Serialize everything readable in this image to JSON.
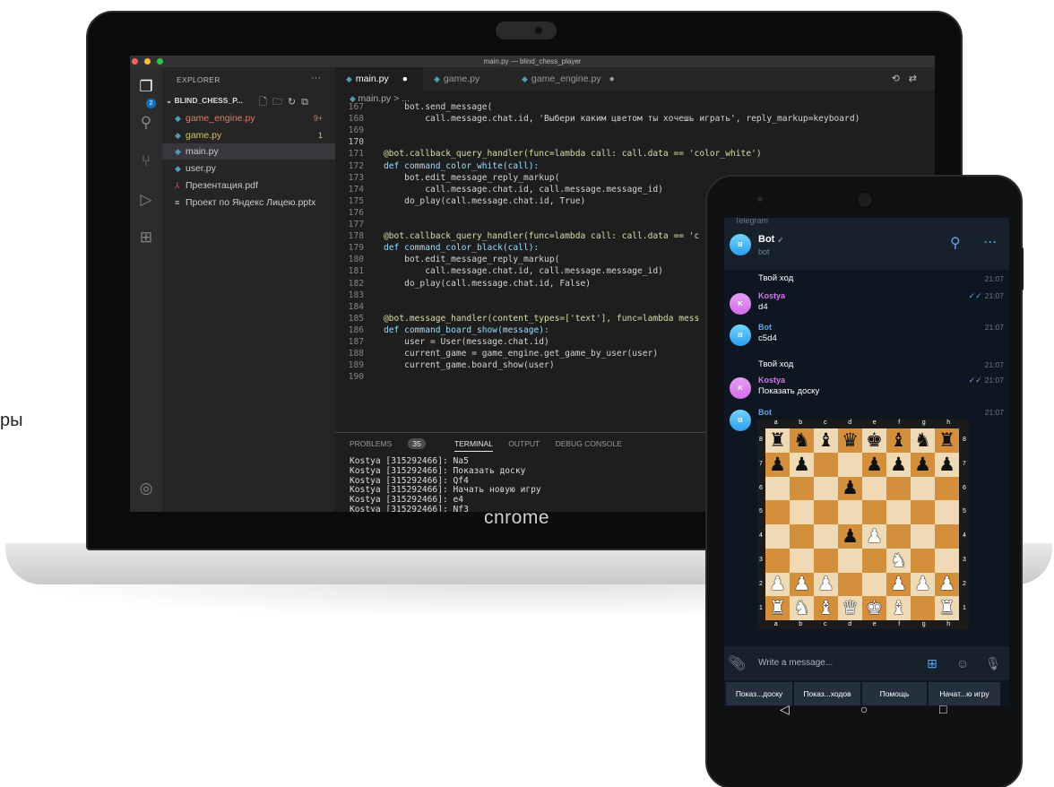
{
  "side_text": "ры",
  "laptop": {
    "brand": "cnrome",
    "window_title": "main.py — blind_chess_player",
    "explorer": {
      "header": "EXPLORER",
      "more": "···",
      "project": "BLIND_CHESS_P...",
      "files": [
        {
          "name": "game_engine.py",
          "count": "9+",
          "color": "#e07b68",
          "icon": "py"
        },
        {
          "name": "game.py",
          "count": "1",
          "color": "#d8c15f",
          "icon": "py"
        },
        {
          "name": "main.py",
          "count": "",
          "color": "#cccccc",
          "icon": "py"
        },
        {
          "name": "user.py",
          "count": "",
          "color": "#cccccc",
          "icon": "py"
        },
        {
          "name": "Презентация.pdf",
          "count": "",
          "color": "#cccccc",
          "icon": "pdf"
        },
        {
          "name": "Проект по Яндекс Лицею.pptx",
          "count": "",
          "color": "#cccccc",
          "icon": "pptx"
        }
      ],
      "activity_badge": "2"
    },
    "tabs": [
      {
        "label": "main.py",
        "marker": "●"
      },
      {
        "label": "game.py",
        "marker": ""
      },
      {
        "label": "game_engine.py",
        "marker": "●"
      }
    ],
    "breadcrumb": "main.py > ...",
    "code_lines": [
      {
        "no": "167",
        "text": "    bot.send_message("
      },
      {
        "no": "168",
        "text": "        call.message.chat.id, 'Выбери каким цветом ты хочешь играть', reply_markup=keyboard)"
      },
      {
        "no": "169",
        "text": ""
      },
      {
        "no": "170",
        "text": ""
      },
      {
        "no": "171",
        "text": "@bot.callback_query_handler(func=lambda call: call.data == 'color_white')"
      },
      {
        "no": "172",
        "text": "def command_color_white(call):"
      },
      {
        "no": "173",
        "text": "    bot.edit_message_reply_markup("
      },
      {
        "no": "174",
        "text": "        call.message.chat.id, call.message.message_id)"
      },
      {
        "no": "175",
        "text": "    do_play(call.message.chat.id, True)"
      },
      {
        "no": "176",
        "text": ""
      },
      {
        "no": "177",
        "text": ""
      },
      {
        "no": "178",
        "text": "@bot.callback_query_handler(func=lambda call: call.data == 'c"
      },
      {
        "no": "179",
        "text": "def command_color_black(call):"
      },
      {
        "no": "180",
        "text": "    bot.edit_message_reply_markup("
      },
      {
        "no": "181",
        "text": "        call.message.chat.id, call.message.message_id)"
      },
      {
        "no": "182",
        "text": "    do_play(call.message.chat.id, False)"
      },
      {
        "no": "183",
        "text": ""
      },
      {
        "no": "184",
        "text": ""
      },
      {
        "no": "185",
        "text": "@bot.message_handler(content_types=['text'], func=lambda mess"
      },
      {
        "no": "186",
        "text": "def command_board_show(message):"
      },
      {
        "no": "187",
        "text": "    user = User(message.chat.id)"
      },
      {
        "no": "188",
        "text": "    current_game = game_engine.get_game_by_user(user)"
      },
      {
        "no": "189",
        "text": "    current_game.board_show(user)"
      },
      {
        "no": "190",
        "text": ""
      }
    ],
    "panel_tabs": {
      "problems": "PROBLEMS",
      "problems_count": "35",
      "terminal": "TERMINAL",
      "output": "OUTPUT",
      "debug": "DEBUG CONSOLE"
    },
    "terminal_lines": [
      "Kostya [315292466]: Na5",
      "Kostya [315292466]: Показать доску",
      "Kostya [315292466]: Qf4",
      "Kostya [315292466]: Начать новую игру",
      "Kostya [315292466]: e4",
      "Kostya [315292466]: Nf3"
    ]
  },
  "phone": {
    "app_label": "Telegram",
    "chat_name": "Bot",
    "chat_sub": "bot",
    "avatar_letter": "B",
    "messages": [
      {
        "who": "",
        "text": "Твой ход",
        "time": "21:07",
        "read": false
      },
      {
        "who": "Kostya",
        "text": "d4",
        "time": "21:07",
        "read": true
      },
      {
        "who": "Bot",
        "text": "c5d4",
        "time": "21:07",
        "read": false
      },
      {
        "who": "",
        "text": "Твой ход",
        "time": "21:07",
        "read": false
      },
      {
        "who": "Kostya",
        "text": "Показать доску",
        "time": "21:07",
        "read": true
      },
      {
        "who": "Bot",
        "text": "",
        "time": "21:07",
        "read": false
      }
    ],
    "user_letter": "K",
    "board": {
      "files": [
        "a",
        "b",
        "c",
        "d",
        "e",
        "f",
        "g",
        "h"
      ],
      "ranks": [
        "8",
        "7",
        "6",
        "5",
        "4",
        "3",
        "2",
        "1"
      ],
      "position": [
        [
          "br",
          "bn",
          "bb",
          "bq",
          "bk",
          "bb",
          "bn",
          "br"
        ],
        [
          "bp",
          "bp",
          "",
          "",
          "bp",
          "bp",
          "bp",
          "bp"
        ],
        [
          "",
          "",
          "",
          "bp",
          "",
          "",
          "",
          ""
        ],
        [
          "",
          "",
          "",
          "",
          "",
          "",
          "",
          ""
        ],
        [
          "",
          "",
          "",
          "bp",
          "wp",
          "",
          "",
          ""
        ],
        [
          "",
          "",
          "",
          "",
          "",
          "wn",
          "",
          ""
        ],
        [
          "wp",
          "wp",
          "wp",
          "",
          "",
          "wp",
          "wp",
          "wp"
        ],
        [
          "wr",
          "wn",
          "wb",
          "wq",
          "wk",
          "wb",
          "",
          "wr"
        ]
      ]
    },
    "input_placeholder": "Write a message...",
    "keyboard": [
      "Показ...доску",
      "Показ...ходов",
      "Помощь",
      "Начат...ю игру"
    ]
  }
}
